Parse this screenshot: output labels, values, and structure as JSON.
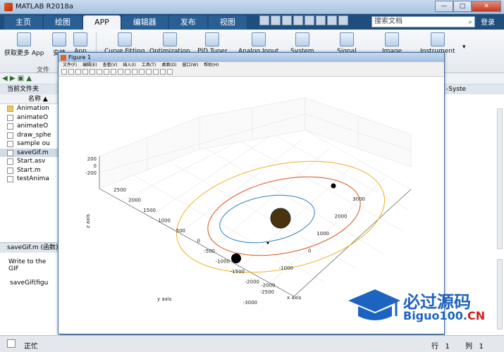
{
  "window": {
    "title": "MATLAB R2018a",
    "controls": [
      "—",
      "□",
      "✕"
    ]
  },
  "tabs": [
    "主页",
    "绘图",
    "APP",
    "编辑器",
    "发布",
    "视图"
  ],
  "search": {
    "placeholder": "搜索文档"
  },
  "login_label": "登录",
  "ribbon": {
    "get_more": "获取更多 App",
    "install": "安装",
    "package": "App",
    "group_label": "文件",
    "apps": [
      "Curve Fitting",
      "Optimization",
      "PID Tuner",
      "Analog Input",
      "System",
      "Signal",
      "Image",
      "Instrument"
    ]
  },
  "left": {
    "current_folder": "当前文件夹",
    "col_name": "名称 ▲",
    "files": [
      "Animation",
      "animateO",
      "animateO",
      "draw_sphe",
      "sample ou",
      "saveGif.m",
      "Start.asv",
      "Start.m",
      "testAnima"
    ],
    "selected_index": 5,
    "detail_header": "saveGif.m  (函数)",
    "detail_text": "Write to the GIF",
    "detail_func": "saveGif(figu"
  },
  "right": {
    "header": "-Syste"
  },
  "figure": {
    "title": "Figure 1",
    "menu": [
      "文件(F)",
      "编辑(E)",
      "查看(V)",
      "插入(I)",
      "工具(T)",
      "桌面(D)",
      "窗口(W)",
      "帮助(H)"
    ],
    "xlabel": "x axis",
    "ylabel": "y axis",
    "zlabel": "z axis",
    "xticks": [
      "-3000",
      "-2000",
      "-1000",
      "0",
      "1000",
      "2000",
      "3000"
    ],
    "yticks": [
      "2500",
      "2000",
      "1500",
      "1000",
      "500",
      "0",
      "-500",
      "-1000",
      "-1500",
      "-2000",
      "-2500"
    ],
    "zticks": [
      "200",
      "0",
      "-200"
    ]
  },
  "status": {
    "ready": "正忙",
    "row_label": "行",
    "row": "1",
    "col_label": "列",
    "col": "1"
  },
  "watermark": {
    "cn": "必过源码",
    "en_prefix": "Biguo100.",
    "en_suffix": "CN"
  },
  "colors": {
    "orbit1": "#2f7fc1",
    "orbit2": "#d9541a",
    "orbit3": "#edb120"
  }
}
